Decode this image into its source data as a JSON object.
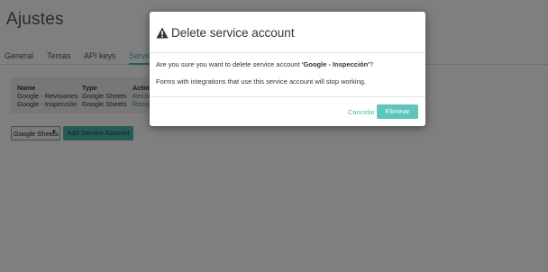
{
  "page": {
    "title": "Ajustes",
    "tabs": [
      "General",
      "Temas",
      "API keys",
      "Servic"
    ],
    "active_tab_index": 3
  },
  "table": {
    "headers": [
      "Name",
      "Type",
      "Actio"
    ],
    "rows": [
      {
        "name": "Google - Revisiones",
        "type": "Google Sheets",
        "action": "Recon"
      },
      {
        "name": "Google - Inspección",
        "type": "Google Sheets",
        "action": "Recon"
      }
    ]
  },
  "controls": {
    "type_select_value": "Google Sheets",
    "add_button_label": "Add Service Account"
  },
  "modal": {
    "title": "Delete service account",
    "warning_icon": "warning-triangle-icon",
    "question_prefix": "Are you sure you want to delete service account ",
    "account_name": "'Google - Inspección'",
    "question_suffix": "?",
    "note": "Forms with integrations that use this service account will stop working.",
    "cancel_label": "Cancelar",
    "confirm_label": "Eliminar"
  },
  "colors": {
    "accent": "#4bb8b0",
    "confirm_button": "#5ec4bd",
    "overlay": "rgba(0,0,0,0.5)"
  }
}
